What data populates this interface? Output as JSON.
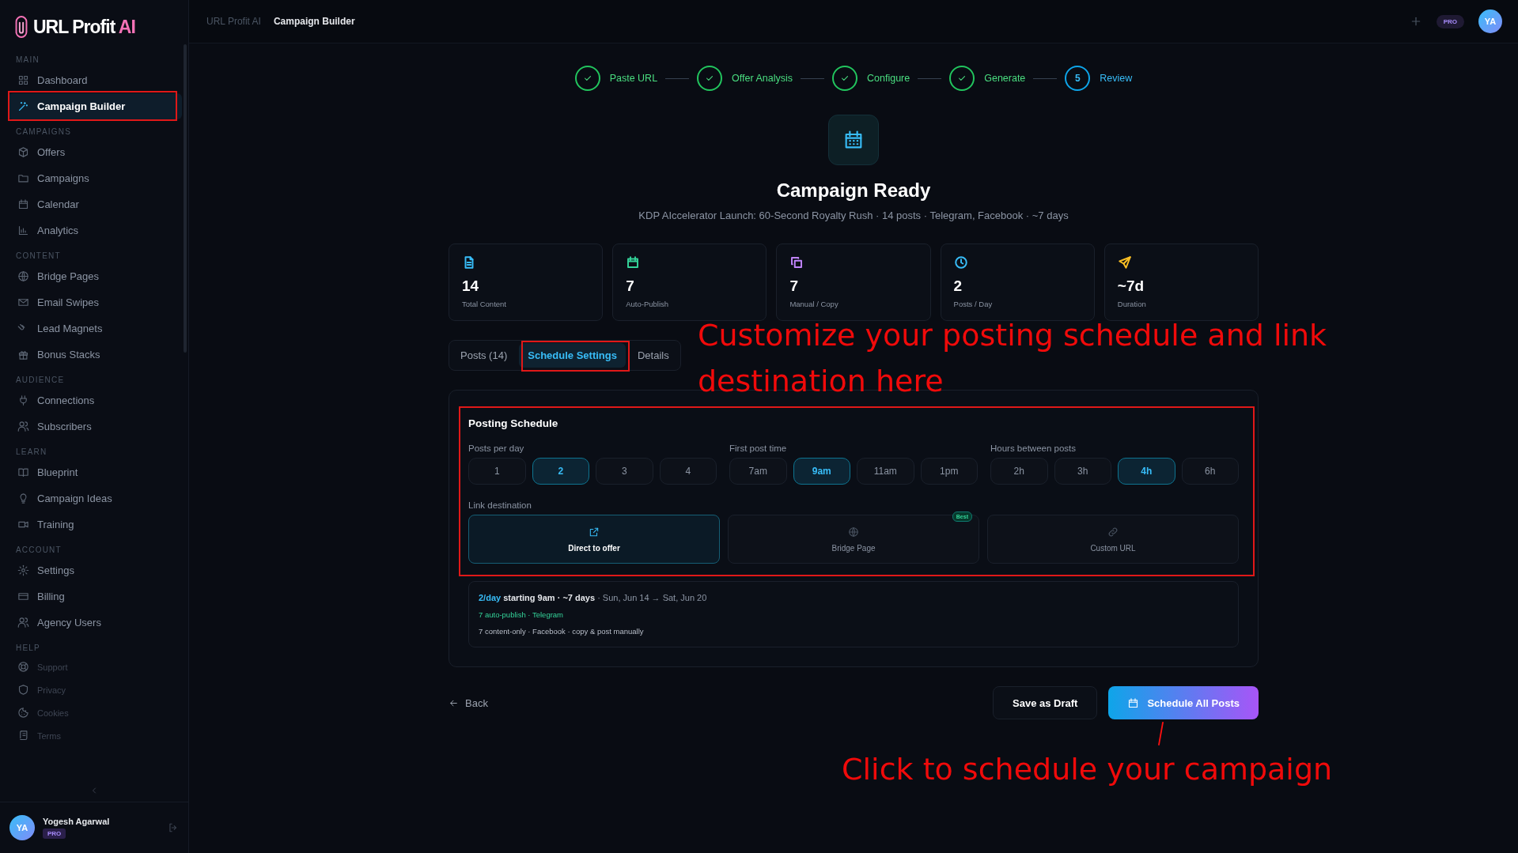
{
  "brand": {
    "name": "URL Profit ",
    "accent": "AI"
  },
  "sidebar": {
    "sections": [
      {
        "heading": "MAIN",
        "items": [
          {
            "label": "Dashboard",
            "selected": false,
            "kind": "nav"
          },
          {
            "label": "Campaign Builder",
            "selected": true,
            "kind": "nav"
          }
        ]
      },
      {
        "heading": "CAMPAIGNS",
        "items": [
          {
            "label": "Offers",
            "selected": false,
            "kind": "nav"
          },
          {
            "label": "Campaigns",
            "selected": false,
            "kind": "nav"
          },
          {
            "label": "Calendar",
            "selected": false,
            "kind": "nav"
          },
          {
            "label": "Analytics",
            "selected": false,
            "kind": "nav"
          }
        ]
      },
      {
        "heading": "CONTENT",
        "items": [
          {
            "label": "Bridge Pages",
            "selected": false,
            "kind": "nav"
          },
          {
            "label": "Email Swipes",
            "selected": false,
            "kind": "nav"
          },
          {
            "label": "Lead Magnets",
            "selected": false,
            "kind": "nav"
          },
          {
            "label": "Bonus Stacks",
            "selected": false,
            "kind": "nav"
          }
        ]
      },
      {
        "heading": "AUDIENCE",
        "items": [
          {
            "label": "Connections",
            "selected": false,
            "kind": "nav"
          },
          {
            "label": "Subscribers",
            "selected": false,
            "kind": "nav"
          }
        ]
      },
      {
        "heading": "LEARN",
        "items": [
          {
            "label": "Blueprint",
            "selected": false,
            "kind": "nav"
          },
          {
            "label": "Campaign Ideas",
            "selected": false,
            "kind": "nav"
          },
          {
            "label": "Training",
            "selected": false,
            "kind": "nav"
          }
        ]
      },
      {
        "heading": "ACCOUNT",
        "items": [
          {
            "label": "Settings",
            "selected": false,
            "kind": "nav"
          },
          {
            "label": "Billing",
            "selected": false,
            "kind": "nav"
          },
          {
            "label": "Agency Users",
            "selected": false,
            "kind": "nav"
          }
        ]
      },
      {
        "heading": "HELP",
        "items": [
          {
            "label": "Support",
            "selected": false,
            "kind": "minor"
          },
          {
            "label": "Privacy",
            "selected": false,
            "kind": "minor"
          },
          {
            "label": "Cookies",
            "selected": false,
            "kind": "minor"
          },
          {
            "label": "Terms",
            "selected": false,
            "kind": "minor"
          }
        ]
      }
    ],
    "user": {
      "initials": "YA",
      "name": "Yogesh Agarwal",
      "plan": "PRO"
    }
  },
  "breadcrumb": [
    "URL Profit AI",
    "Campaign Builder"
  ],
  "topbar": {
    "plan": "PRO",
    "initials": "YA"
  },
  "steps": [
    {
      "label": "Paste URL",
      "completed": true
    },
    {
      "label": "Offer Analysis",
      "completed": true
    },
    {
      "label": "Configure",
      "completed": true
    },
    {
      "label": "Generate",
      "completed": true
    },
    {
      "label": "Review",
      "completed": false,
      "number": "5"
    }
  ],
  "title": "Campaign Ready",
  "subtitle": "KDP AIccelerator Launch: 60-Second Royalty Rush · 14 posts · Telegram, Facebook · ~7 days",
  "stats": [
    {
      "value": "14",
      "label": "Total Content",
      "color": "#38bdf8"
    },
    {
      "value": "7",
      "label": "Auto-Publish",
      "color": "#34d399"
    },
    {
      "value": "7",
      "label": "Manual / Copy",
      "color": "#c084fc"
    },
    {
      "value": "2",
      "label": "Posts / Day",
      "color": "#38bdf8"
    },
    {
      "value": "~7d",
      "label": "Duration",
      "color": "#fbbf24"
    }
  ],
  "tabs": [
    {
      "label": "Posts (14)",
      "selected": false
    },
    {
      "label": "Schedule Settings",
      "selected": true
    },
    {
      "label": "Details",
      "selected": false
    }
  ],
  "schedule": {
    "title": "Posting Schedule",
    "groups": [
      {
        "label": "Posts per day",
        "options": [
          {
            "label": "1",
            "selected": false
          },
          {
            "label": "2",
            "selected": true
          },
          {
            "label": "3",
            "selected": false
          },
          {
            "label": "4",
            "selected": false
          }
        ]
      },
      {
        "label": "First post time",
        "options": [
          {
            "label": "7am",
            "selected": false
          },
          {
            "label": "9am",
            "selected": true
          },
          {
            "label": "11am",
            "selected": false
          },
          {
            "label": "1pm",
            "selected": false
          }
        ]
      },
      {
        "label": "Hours between posts",
        "options": [
          {
            "label": "2h",
            "selected": false
          },
          {
            "label": "3h",
            "selected": false
          },
          {
            "label": "4h",
            "selected": true
          },
          {
            "label": "6h",
            "selected": false
          }
        ]
      }
    ],
    "link_label": "Link destination",
    "destinations": [
      {
        "label": "Direct to offer",
        "selected": true
      },
      {
        "label": "Bridge Page",
        "selected": false,
        "badge": "Best"
      },
      {
        "label": "Custom URL",
        "selected": false
      }
    ],
    "summary": {
      "rate": "2/day",
      "start": "starting 9am · ~7 days",
      "range": "· Sun, Jun 14 → Sat, Jun 20",
      "auto": "7 auto-publish · Telegram",
      "manual": "7 content-only · Facebook · copy & post manually"
    }
  },
  "actions": {
    "back": "Back",
    "draft": "Save as Draft",
    "schedule": "Schedule All Posts"
  },
  "annotations": [
    {
      "text": "Customize your posting schedule and link destination here"
    },
    {
      "text": "Click to schedule your campaign"
    }
  ]
}
